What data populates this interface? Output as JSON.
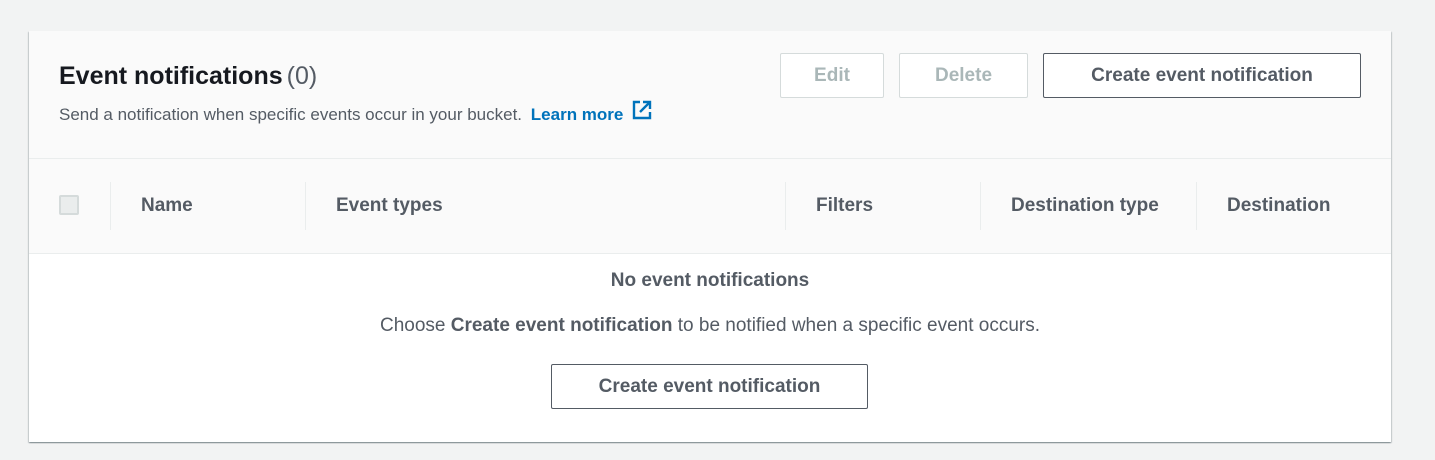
{
  "section": {
    "title": "Event notifications",
    "count": "(0)",
    "description": "Send a notification when specific events occur in your bucket.",
    "learn_more": "Learn more",
    "external_link_icon": "external-link-icon"
  },
  "actions": {
    "edit_label": "Edit",
    "delete_label": "Delete",
    "create_label": "Create event notification"
  },
  "table": {
    "columns": [
      "Name",
      "Event types",
      "Filters",
      "Destination type",
      "Destination"
    ]
  },
  "empty_state": {
    "title": "No event notifications",
    "desc_prefix": "Choose",
    "desc_emphasis": "Create event notification",
    "desc_suffix": "to be notified when a specific event occurs.",
    "button_label": "Create event notification"
  },
  "colors": {
    "link": "#0073bb",
    "text_secondary": "#545b64",
    "disabled": "#aab7b8",
    "header_bg": "#fafafa",
    "page_bg": "#f2f3f3"
  }
}
